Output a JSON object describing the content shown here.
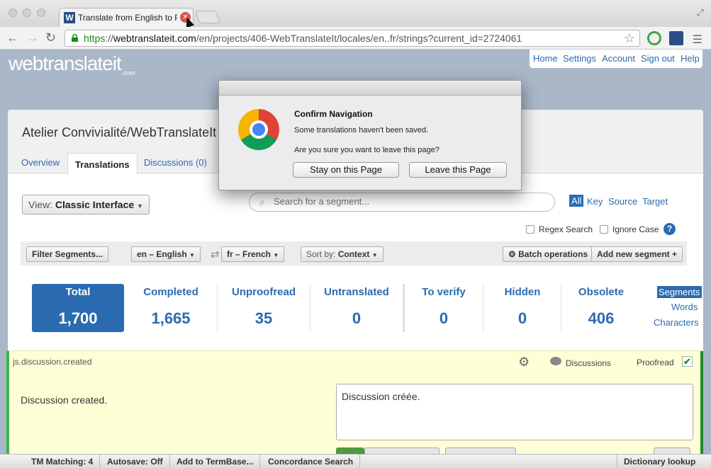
{
  "browser": {
    "tab_title": "Translate from English to F",
    "tab_favicon": "W",
    "url_scheme": "https",
    "url_sep": "://",
    "url_host": "webtranslateit.com",
    "url_path": "/en/projects/406-WebTranslateIt/locales/en..fr/strings?current_id=2724061",
    "icons": [
      "back-icon",
      "forward-icon",
      "reload-icon",
      "lock-icon",
      "star-icon",
      "menu-icon"
    ]
  },
  "site": {
    "logo": "webtranslateit",
    "logo_suffix": ".com",
    "nav": [
      "Home",
      "Settings",
      "Account",
      "Sign out",
      "Help"
    ]
  },
  "project": {
    "title": "Atelier Convivialité/WebTranslateIt",
    "tabs": [
      "Overview",
      "Translations",
      "Discussions (0)"
    ],
    "active_tab": "Translations"
  },
  "controls": {
    "view_prefix": "View:",
    "view_value": "Classic Interface",
    "search_placeholder": "Search for a segment...",
    "scopes": [
      "All",
      "Key",
      "Source",
      "Target"
    ],
    "regex_label": "Regex Search",
    "ignore_case_label": "Ignore Case",
    "help": "?"
  },
  "filterbar": {
    "filter_label": "Filter Segments...",
    "source_locale": "en – English",
    "target_locale": "fr – French",
    "sort_prefix": "Sort by:",
    "sort_value": "Context",
    "batch_label": "Batch operations",
    "add_label": "Add new segment"
  },
  "stats": [
    {
      "label": "Total",
      "value": "1,700"
    },
    {
      "label": "Completed",
      "value": "1,665"
    },
    {
      "label": "Unproofread",
      "value": "35"
    },
    {
      "label": "Untranslated",
      "value": "0"
    },
    {
      "label": "To verify",
      "value": "0"
    },
    {
      "label": "Hidden",
      "value": "0"
    },
    {
      "label": "Obsolete",
      "value": "406"
    }
  ],
  "units": [
    "Segments",
    "Words",
    "Characters"
  ],
  "segment": {
    "key": "js.discussion.created",
    "discussions_label": "Discussions",
    "proofread_label": "Proofread",
    "proofread_mark": "✔",
    "source": "Discussion created.",
    "target": "Discussion créée."
  },
  "statusbar": [
    "TM Matching: 4",
    "Autosave: Off",
    "Add to TermBase...",
    "Concordance Search",
    "Dictionary lookup"
  ],
  "dialog": {
    "title": "Confirm Navigation",
    "message": "Some translations haven't been saved.",
    "question": "Are you sure you want to leave this page?",
    "stay_label": "Stay on this Page",
    "leave_label": "Leave this Page"
  },
  "colors": {
    "accent": "#2a6bb1",
    "segment_bg": "#ffffd7",
    "proofread_green": "#1e9a2d"
  }
}
